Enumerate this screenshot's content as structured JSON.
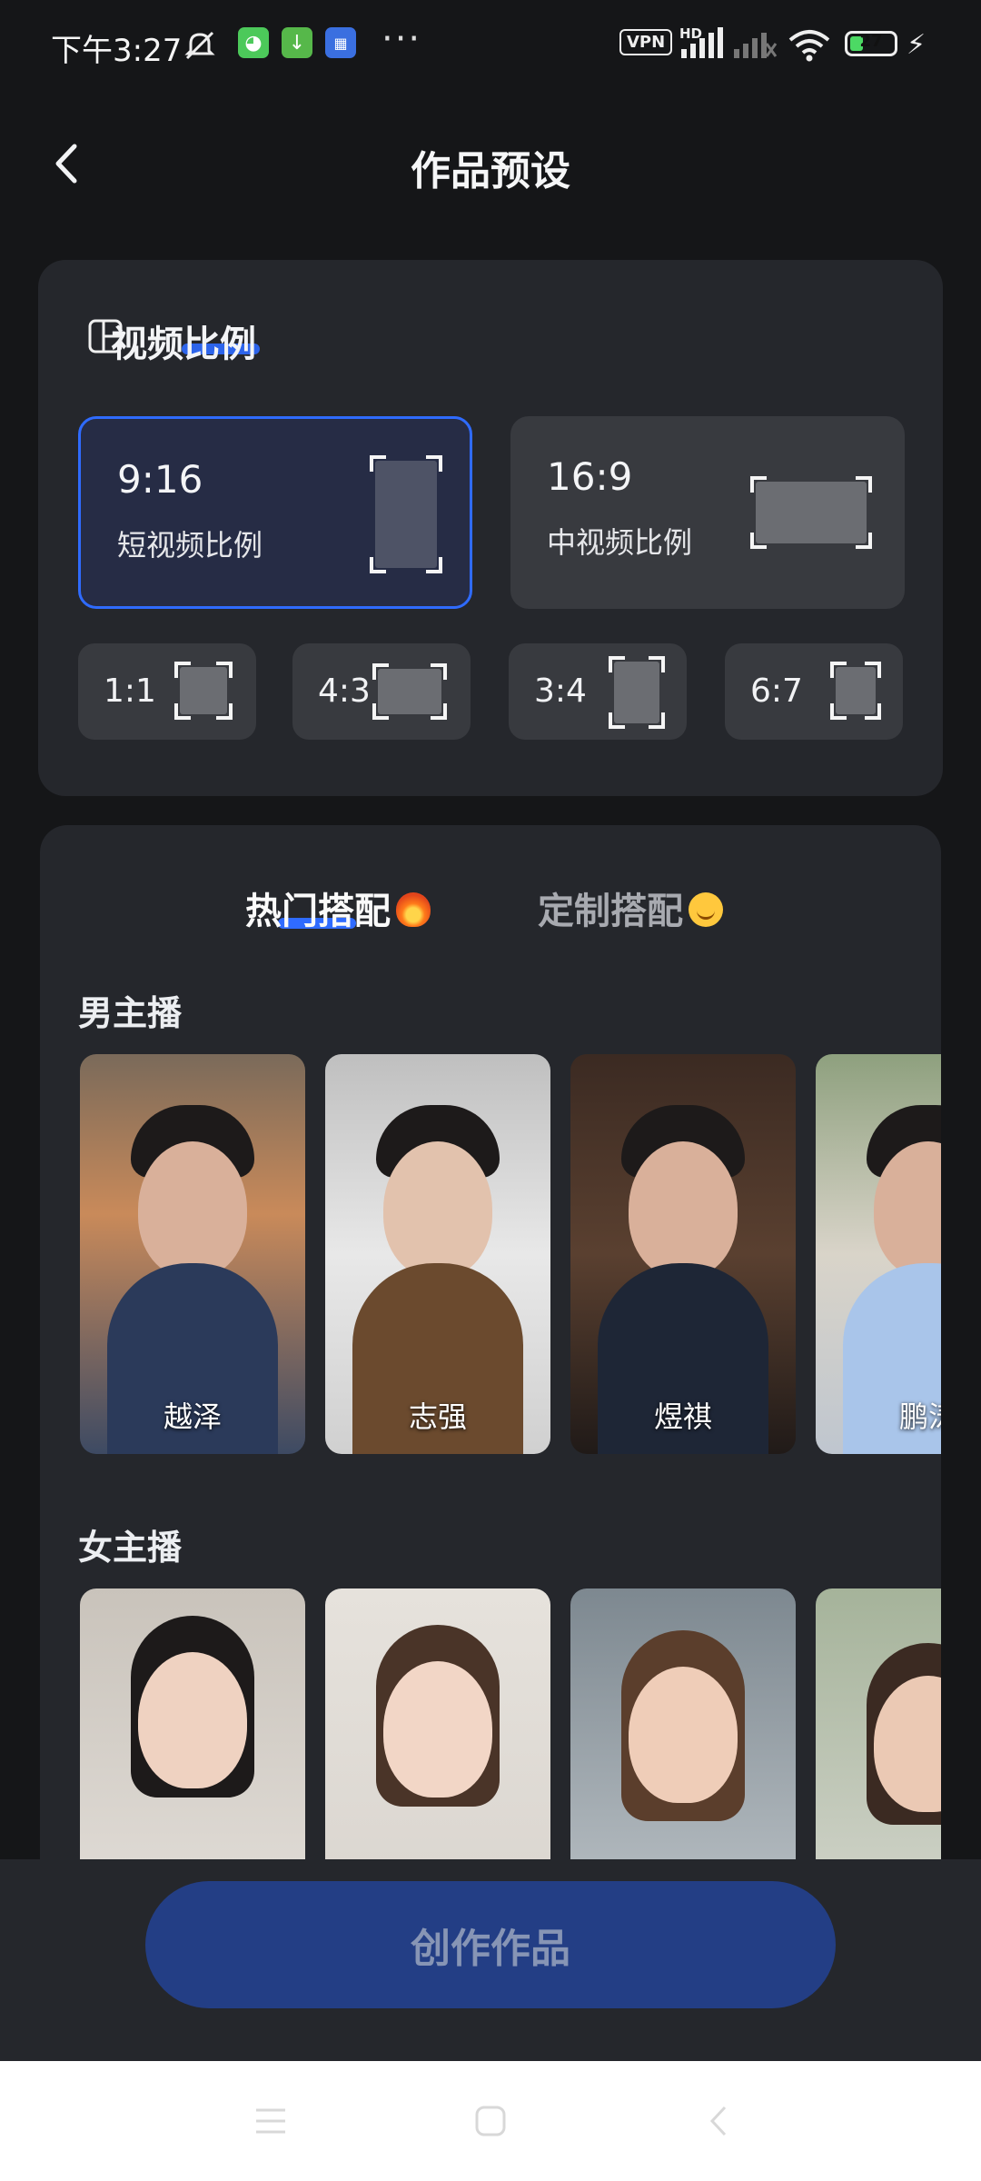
{
  "status_bar": {
    "time": "下午3:27",
    "more": "···",
    "vpn": "VPN",
    "hd": "HD",
    "battery": "27"
  },
  "header": {
    "title": "作品预设"
  },
  "ratio": {
    "section_label": "视频比例",
    "options_large": [
      {
        "ratio": "9:16",
        "desc": "短视频比例",
        "selected": true
      },
      {
        "ratio": "16:9",
        "desc": "中视频比例",
        "selected": false
      }
    ],
    "options_small": [
      "1:1",
      "4:3",
      "3:4",
      "6:7"
    ]
  },
  "tabs": {
    "hot": "热门搭配",
    "custom": "定制搭配",
    "active": "hot"
  },
  "male": {
    "title": "男主播",
    "anchors": [
      "越泽",
      "志强",
      "煜祺",
      "鹏涛"
    ]
  },
  "female": {
    "title": "女主播"
  },
  "actions": {
    "create": "创作作品"
  },
  "colors": {
    "accent": "#2f6bff",
    "panel": "#25272c",
    "background": "#151618",
    "button": "#233e85"
  }
}
